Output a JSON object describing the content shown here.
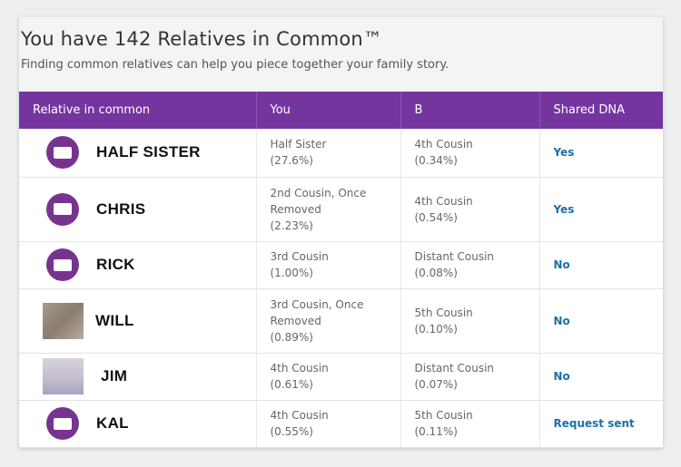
{
  "header": {
    "title": "You have 142 Relatives in Common™",
    "subtitle": "Finding common relatives can help you piece together your family story."
  },
  "table": {
    "columns": [
      "Relative in common",
      "You",
      "B",
      "Shared DNA"
    ],
    "rows": [
      {
        "name": "HALF SISTER",
        "avatar": "default",
        "you_line1": "Half Sister",
        "you_line2": "(27.6%)",
        "you_line3": "",
        "b_line1": "4th Cousin",
        "b_line2": "(0.34%)",
        "shared": "Yes"
      },
      {
        "name": "CHRIS",
        "avatar": "default",
        "you_line1": "2nd Cousin, Once",
        "you_line2": "Removed",
        "you_line3": "(2.23%)",
        "b_line1": "4th Cousin",
        "b_line2": "(0.54%)",
        "shared": "Yes"
      },
      {
        "name": "RICK",
        "avatar": "default",
        "you_line1": "3rd Cousin",
        "you_line2": "(1.00%)",
        "you_line3": "",
        "b_line1": "Distant Cousin",
        "b_line2": "(0.08%)",
        "shared": "No"
      },
      {
        "name": "WILL",
        "avatar": "photo",
        "you_line1": "3rd Cousin, Once",
        "you_line2": "Removed",
        "you_line3": "(0.89%)",
        "b_line1": "5th Cousin",
        "b_line2": "(0.10%)",
        "shared": "No"
      },
      {
        "name": "JIM",
        "avatar": "photo",
        "you_line1": "4th Cousin",
        "you_line2": "(0.61%)",
        "you_line3": "",
        "b_line1": "Distant Cousin",
        "b_line2": "(0.07%)",
        "shared": "No"
      },
      {
        "name": "KAL",
        "avatar": "default",
        "you_line1": "4th Cousin",
        "you_line2": "(0.55%)",
        "you_line3": "",
        "b_line1": "5th Cousin",
        "b_line2": "(0.11%)",
        "shared": "Request sent"
      }
    ]
  },
  "colors": {
    "header_bar": "#74359f",
    "link": "#1d6fa5"
  }
}
